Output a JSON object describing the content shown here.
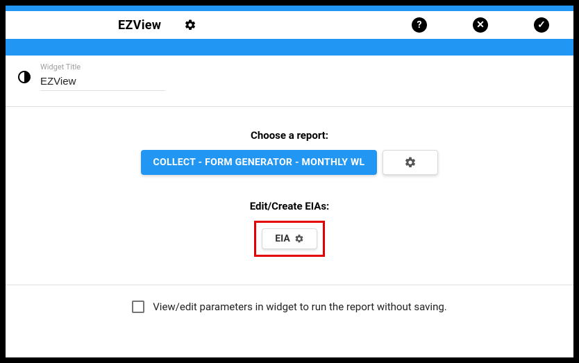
{
  "header": {
    "title": "EZView"
  },
  "widget": {
    "title_label": "Widget Title",
    "title_value": "EZView"
  },
  "sections": {
    "choose_report": "Choose a report:",
    "edit_eias": "Edit/Create EIAs:"
  },
  "buttons": {
    "report": "COLLECT - FORM GENERATOR - MONTHLY WL",
    "eia": "EIA"
  },
  "footer": {
    "checkbox_label": "View/edit parameters in widget to run the report without saving."
  }
}
